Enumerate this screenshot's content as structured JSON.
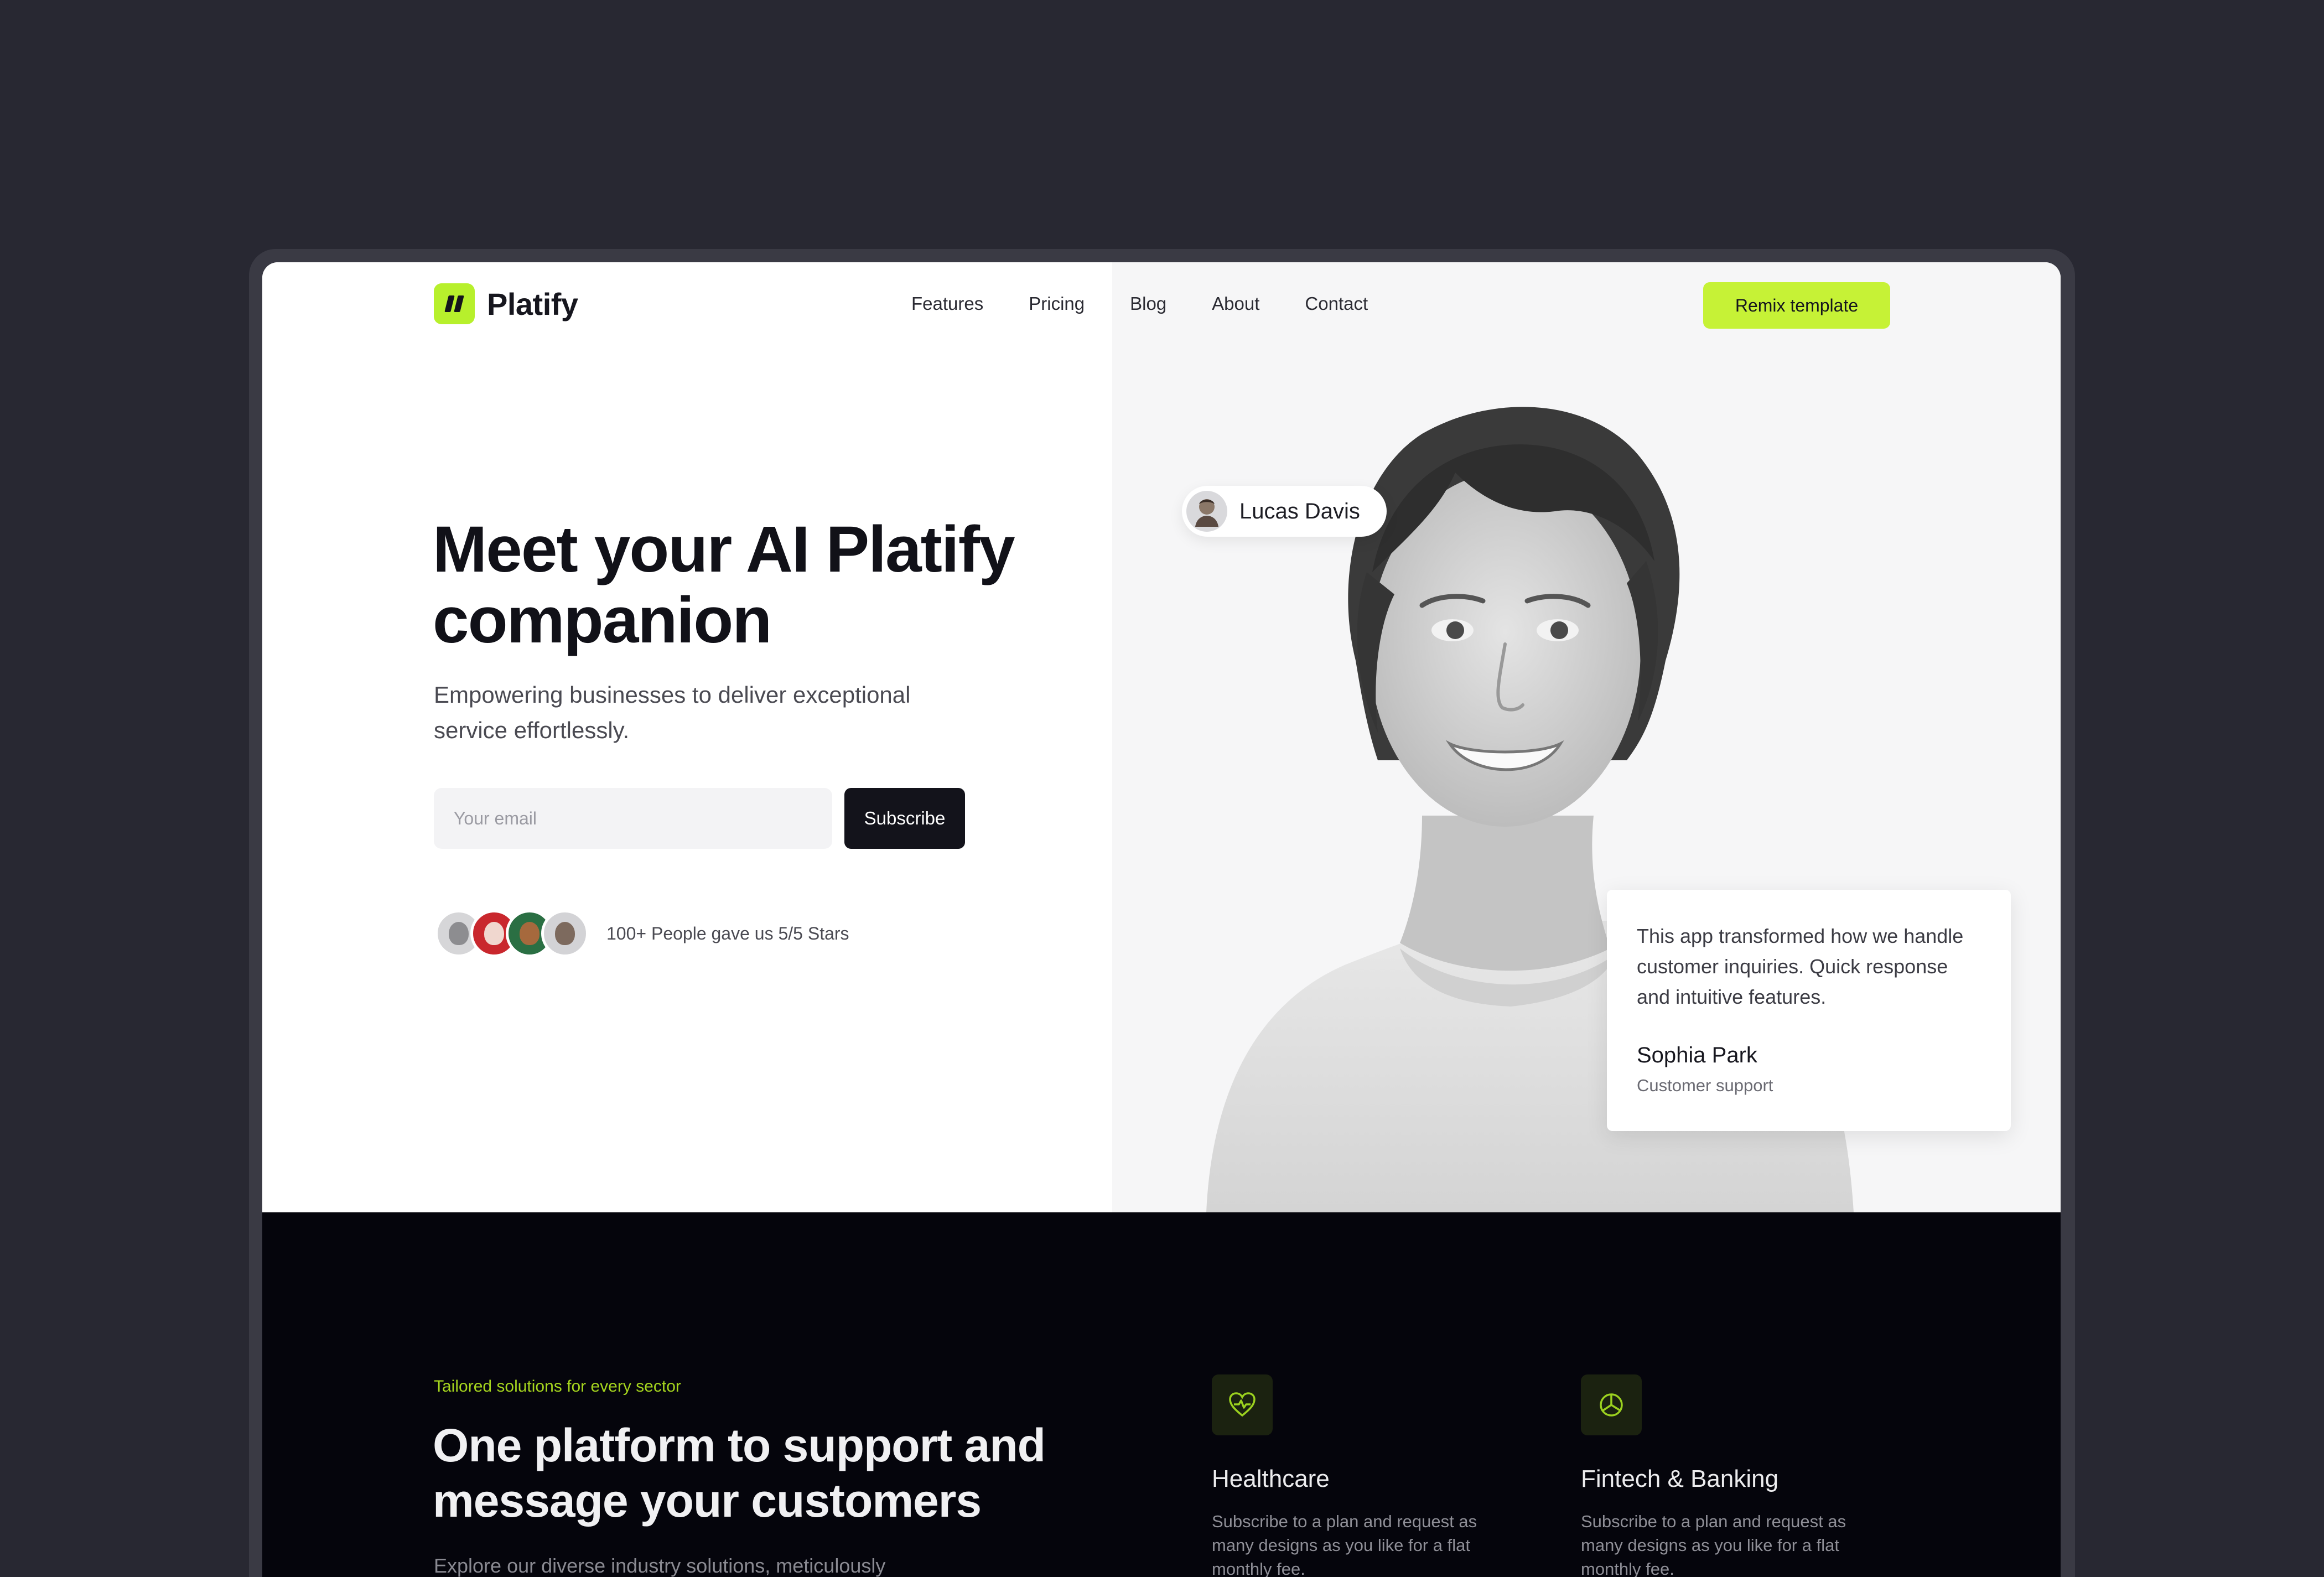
{
  "brand": {
    "name": "Platify",
    "accent": "#c6f236",
    "dark": "#05050c"
  },
  "nav": {
    "items": [
      "Features",
      "Pricing",
      "Blog",
      "About",
      "Contact"
    ],
    "cta": "Remix template"
  },
  "hero": {
    "headline": "Meet your AI Platify companion",
    "subhead": "Empowering businesses to deliver exceptional service effortlessly.",
    "email_placeholder": "Your email",
    "subscribe": "Subscribe",
    "proof": "100+ People gave us 5/5 Stars",
    "name_tag": "Lucas Davis",
    "testimonial": {
      "quote": "This app transformed how we handle customer inquiries. Quick response and intuitive features.",
      "author": "Sophia Park",
      "role": "Customer support"
    }
  },
  "solutions": {
    "eyebrow": "Tailored solutions for every sector",
    "title": "One platform to support and message your customers",
    "subtitle": "Explore our diverse industry solutions, meticulously",
    "industries": [
      {
        "icon": "heart-pulse-icon",
        "title": "Healthcare",
        "desc": "Subscribe to a plan and request as many designs as you like for a flat monthly fee."
      },
      {
        "icon": "pie-chart-icon",
        "title": "Fintech & Banking",
        "desc": "Subscribe to a plan and request as many designs as you like for a flat monthly fee."
      }
    ]
  }
}
